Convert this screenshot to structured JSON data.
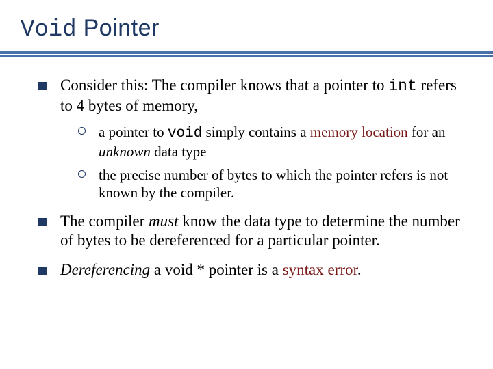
{
  "title": {
    "code": "Void",
    "rest": " Pointer"
  },
  "b1": {
    "pre": "Consider this: The compiler knows that a pointer to ",
    "code": "int",
    "post": " refers to 4 bytes of memory,"
  },
  "s1": {
    "pre": "a pointer to ",
    "code": "void",
    "mid": " simply contains a ",
    "mem": "memory location",
    "mid2": " for an ",
    "unk": "unknown",
    "post": " data type"
  },
  "s2": "the precise number of bytes to which the pointer refers is not known by the compiler.",
  "b2": {
    "pre": "The compiler ",
    "must": "must",
    "post": " know the data type to determine the number of bytes to be dereferenced for a particular pointer."
  },
  "b3": {
    "deref": "Dereferencing",
    "mid": " a void * pointer is a ",
    "err": "syntax error",
    "post": "."
  }
}
